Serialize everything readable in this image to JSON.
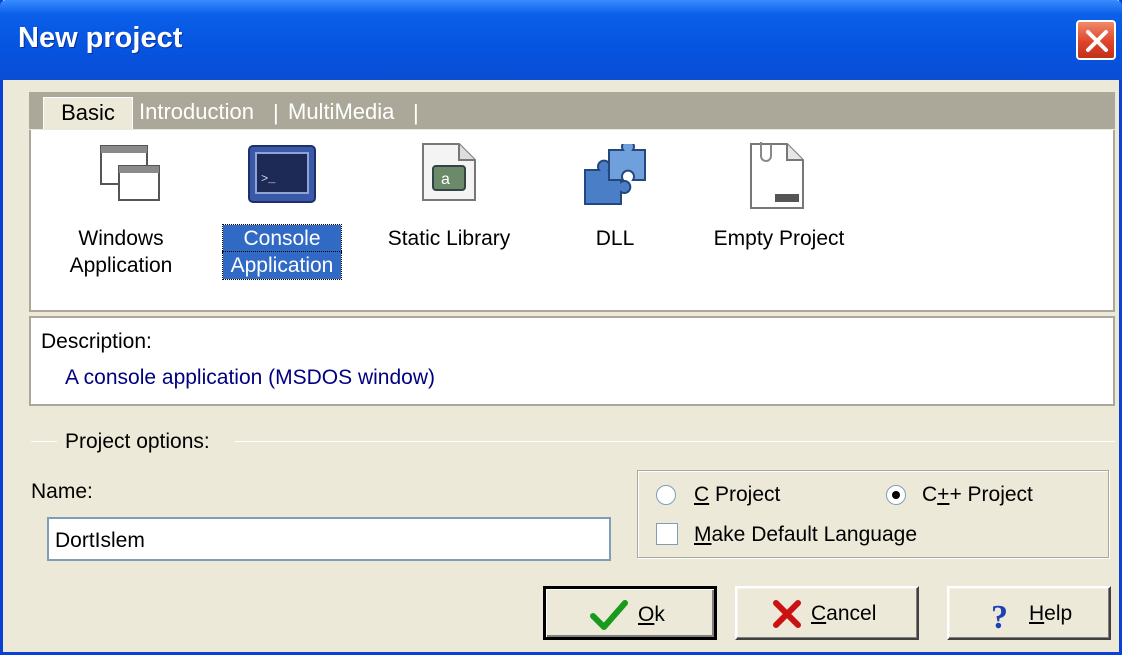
{
  "window": {
    "title": "New project"
  },
  "tabs": [
    {
      "label": "Basic"
    },
    {
      "label": "Introduction"
    },
    {
      "label": "MultiMedia"
    }
  ],
  "projects": {
    "windows": {
      "line1": "Windows",
      "line2": "Application"
    },
    "console": {
      "line1": "Console",
      "line2": "Application"
    },
    "static": {
      "line1": "Static Library"
    },
    "dll": {
      "line1": "DLL"
    },
    "empty": {
      "line1": "Empty Project"
    }
  },
  "description": {
    "label": "Description:",
    "text": "A console application (MSDOS window)"
  },
  "options": {
    "group_label": "Project options:",
    "name_label": "Name:",
    "name_value": "DortIslem",
    "c_project": "C Project",
    "cpp_project": "C++ Project",
    "make_default": "Make Default Language",
    "selected_language": "C++ Project",
    "make_default_checked": false
  },
  "buttons": {
    "ok": "Ok",
    "cancel": "Cancel",
    "help": "Help"
  },
  "colors": {
    "title_bar": "#0654e0",
    "selection": "#316ac5",
    "description_text": "#000080",
    "dialog_bg": "#ece9d8"
  },
  "icons": {
    "close": "close-icon",
    "windows_app": "window-app-icon",
    "console_app": "console-app-icon",
    "static_lib": "library-icon",
    "dll": "puzzle-icon",
    "empty": "empty-document-icon",
    "ok": "checkmark-icon",
    "cancel": "x-mark-icon",
    "help": "question-mark-icon"
  }
}
